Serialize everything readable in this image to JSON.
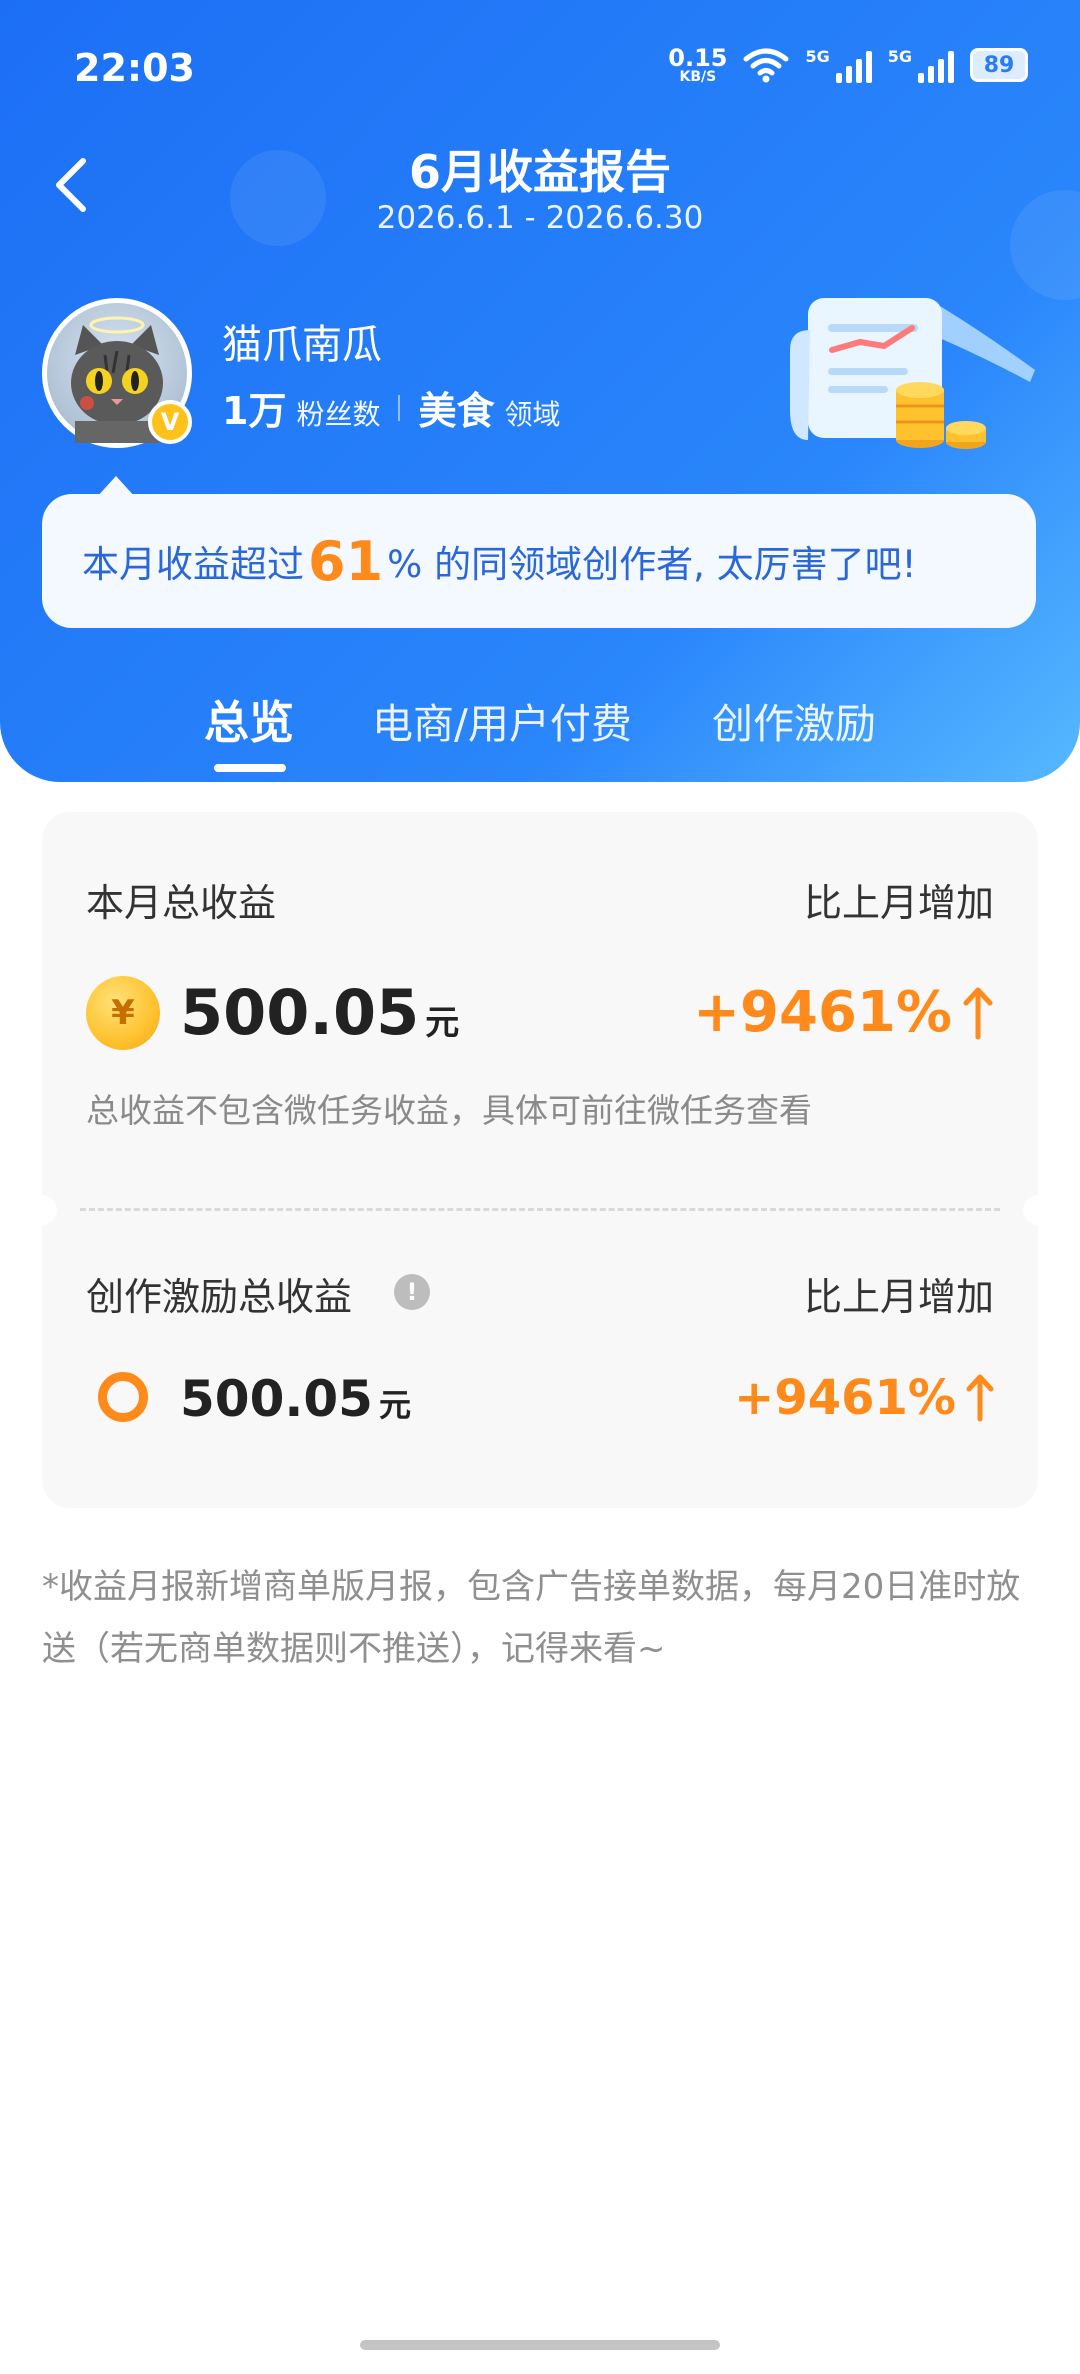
{
  "status_bar": {
    "time": "22:03",
    "net_speed_value": "0.15",
    "net_speed_unit": "KB/S",
    "sim1": "5G",
    "sim2": "5G",
    "battery": "89"
  },
  "header": {
    "title": "6月收益报告",
    "date_range": "2026.6.1 - 2026.6.30"
  },
  "profile": {
    "name": "猫爪南瓜",
    "badge": "V",
    "fans_count": "1万",
    "fans_label": "粉丝数",
    "domain_name": "美食",
    "domain_label": "领域"
  },
  "banner": {
    "prefix": "本月收益超过 ",
    "percent_value": "61",
    "suffix": "% 的同领域创作者, 太厉害了吧!"
  },
  "tabs": [
    {
      "label": "总览",
      "active": true
    },
    {
      "label": "电商/用户付费",
      "active": false
    },
    {
      "label": "创作激励",
      "active": false
    }
  ],
  "summary": {
    "total_label": "本月总收益",
    "compare_label": "比上月增加",
    "coin_symbol": "¥",
    "total_amount": "500.05",
    "unit": "元",
    "growth": "+9461%",
    "note": "总收益不包含微任务收益，具体可前往微任务查看"
  },
  "incentive": {
    "label": "创作激励总收益",
    "info_symbol": "!",
    "compare_label": "比上月增加",
    "amount": "500.05",
    "unit": "元",
    "growth": "+9461%"
  },
  "footnote": "*收益月报新增商单版月报，包含广告接单数据，每月20日准时放送（若无商单数据则不推送），记得来看~",
  "colors": {
    "primary_blue": "#1c6ff5",
    "accent_orange": "#ff8a1c",
    "card_bg": "#f8f8f8"
  }
}
